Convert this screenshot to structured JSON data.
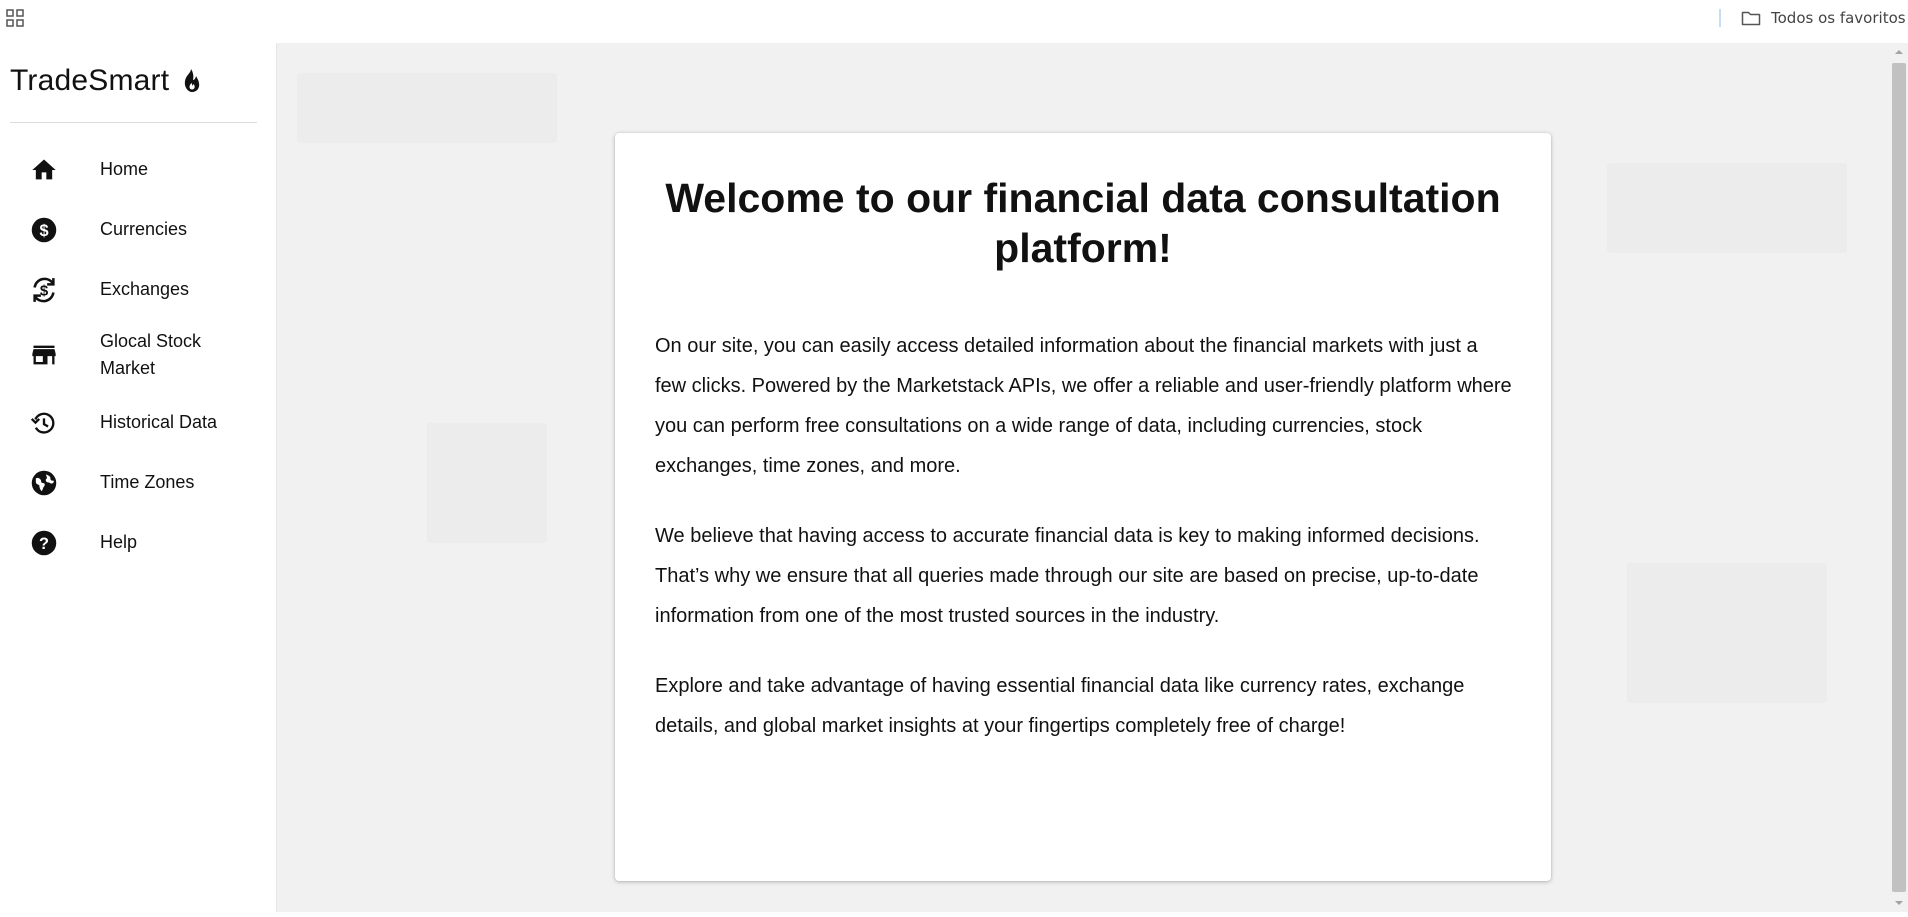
{
  "bookmarks_bar": {
    "apps_icon": "apps-grid-icon",
    "all_bookmarks_icon": "folder-icon",
    "all_bookmarks_label": "Todos os favoritos"
  },
  "sidebar": {
    "brand": "TradeSmart",
    "brand_icon": "flame-icon",
    "items": [
      {
        "label": "Home",
        "icon": "home-icon"
      },
      {
        "label": "Currencies",
        "icon": "dollar-circle-icon"
      },
      {
        "label": "Exchanges",
        "icon": "currency-exchange-icon"
      },
      {
        "label": "Glocal Stock Market",
        "icon": "store-icon"
      },
      {
        "label": "Historical Data",
        "icon": "history-icon"
      },
      {
        "label": "Time Zones",
        "icon": "globe-icon"
      },
      {
        "label": "Help",
        "icon": "help-circle-icon"
      }
    ]
  },
  "main": {
    "title": "Welcome to our financial data consultation platform!",
    "paragraphs": [
      "On our site, you can easily access detailed information about the financial markets with just a few clicks. Powered by the Marketstack APIs, we offer a reliable and user-friendly platform where you can perform free consultations on a wide range of data, including currencies, stock exchanges, time zones, and more.",
      "We believe that having access to accurate financial data is key to making informed decisions. That’s why we ensure that all queries made through our site are based on precise, up-to-date information from one of the most trusted sources in the industry.",
      "Explore and take advantage of having essential financial data like currency rates, exchange details, and global market insights at your fingertips completely free of charge!"
    ]
  },
  "colors": {
    "page_background": "#f1f1f1",
    "card_background": "#ffffff",
    "text": "#111111",
    "scrollbar_thumb": "#c1c1c1"
  }
}
